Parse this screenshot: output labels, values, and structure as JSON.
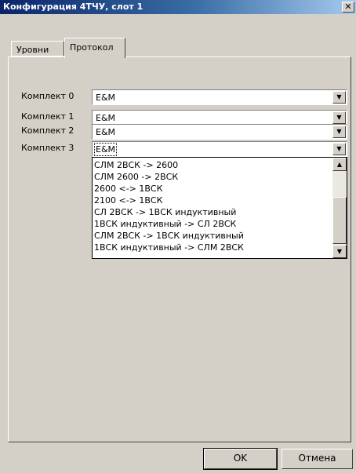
{
  "window": {
    "title": "Конфигурация 4ТЧУ, слот 1",
    "close_glyph": "✕"
  },
  "tabs": [
    {
      "label": "Уровни",
      "active": false
    },
    {
      "label": "Протокол",
      "active": true
    }
  ],
  "sets": [
    {
      "label": "Комплект 0",
      "value": "E&M"
    },
    {
      "label": "Комплект 1",
      "value": "E&M"
    },
    {
      "label": "Комплект 2",
      "value": "E&M"
    },
    {
      "label": "Комплект 3",
      "value": "E&M"
    }
  ],
  "dropdown": {
    "options": [
      "СЛМ 2ВСК -> 2600",
      "СЛМ 2600 -> 2ВСК",
      "2600 <-> 1ВСК",
      "2100 <-> 1ВСК",
      "СЛ 2ВСК -> 1ВСК индуктивный",
      "1ВСК индуктивный -> СЛ 2ВСК",
      "СЛМ 2ВСК -> 1ВСК индуктивный",
      "1ВСК индуктивный -> СЛМ 2ВСК"
    ]
  },
  "buttons": {
    "ok": "OK",
    "cancel": "Отмена"
  },
  "icons": {
    "combo_arrow": "▼",
    "scroll_up": "▲",
    "scroll_down": "▼"
  }
}
